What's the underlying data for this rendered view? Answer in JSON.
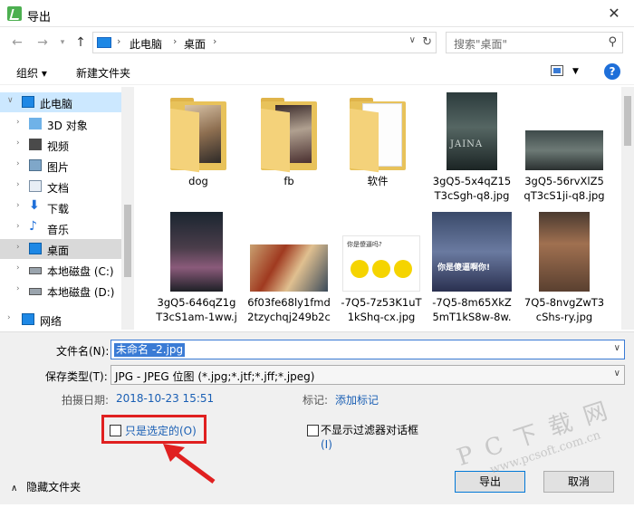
{
  "window": {
    "title": "导出",
    "close_glyph": "✕"
  },
  "nav": {
    "back": "←",
    "forward": "→",
    "up": "↑",
    "breadcrumb": [
      "此电脑",
      "桌面"
    ],
    "search_placeholder": "搜索\"桌面\""
  },
  "toolbar": {
    "organize": "组织 ▾",
    "new_folder": "新建文件夹",
    "help": "?"
  },
  "sidebar": {
    "items": [
      {
        "label": "此电脑",
        "icon": "pc-icon"
      },
      {
        "label": "3D 对象",
        "icon": "cube-icon"
      },
      {
        "label": "视频",
        "icon": "video-icon"
      },
      {
        "label": "图片",
        "icon": "picture-icon"
      },
      {
        "label": "文档",
        "icon": "document-icon"
      },
      {
        "label": "下载",
        "icon": "download-icon"
      },
      {
        "label": "音乐",
        "icon": "music-icon"
      },
      {
        "label": "桌面",
        "icon": "desktop-icon"
      },
      {
        "label": "本地磁盘 (C:)",
        "icon": "drive-icon"
      },
      {
        "label": "本地磁盘 (D:)",
        "icon": "drive-icon"
      },
      {
        "label": "网络",
        "icon": "network-icon"
      }
    ]
  },
  "files": [
    {
      "name": "dog",
      "kind": "folder"
    },
    {
      "name": "fb",
      "kind": "folder"
    },
    {
      "name": "软件",
      "kind": "folder"
    },
    {
      "name_l1": "3gQ5-5x4qZ15",
      "name_l2": "T3cSgh-q8.jpg",
      "kind": "image",
      "caption": "JAINA"
    },
    {
      "name_l1": "3gQ5-56rvXlZ5",
      "name_l2": "qT3cS1ji-q8.jpg",
      "kind": "image"
    },
    {
      "name_l1": "3gQ5-646qZ1g",
      "name_l2": "T3cS1am-1ww.j",
      "kind": "image"
    },
    {
      "name_l1": "6f03fe68ly1fmd",
      "name_l2": "2tzychqj249b2c",
      "kind": "image"
    },
    {
      "name_l1": "-7Q5-7z53K1uT",
      "name_l2": "1kShq-cx.jpg",
      "kind": "image",
      "caption": "你是傻逼吗?"
    },
    {
      "name_l1": "-7Q5-8m65XkZ",
      "name_l2": "5mT1kS8w-8w.",
      "kind": "image",
      "caption": "你是傻逼啊你!"
    },
    {
      "name_l1": "7Q5-8nvgZwT3",
      "name_l2": "cShs-ry.jpg",
      "kind": "image"
    }
  ],
  "form": {
    "filename_label": "文件名(N):",
    "filename_value": "未命名 -2.jpg",
    "filetype_label": "保存类型(T):",
    "filetype_value": "JPG - JPEG 位图 (*.jpg;*.jtf;*.jff;*.jpeg)",
    "date_label": "拍摄日期:",
    "date_value": "2018-10-23 15:51",
    "tags_label": "标记:",
    "tags_value": "添加标记",
    "only_selected": "只是选定的(O)",
    "no_filter": "不显示过滤器对话框",
    "no_filter_key": "(I)",
    "hide_folders": "隐藏文件夹",
    "export_btn": "导出",
    "cancel_btn": "取消"
  },
  "watermark": {
    "big": "P C 下 载 网",
    "small": "www.pcsoft.com.cn"
  }
}
